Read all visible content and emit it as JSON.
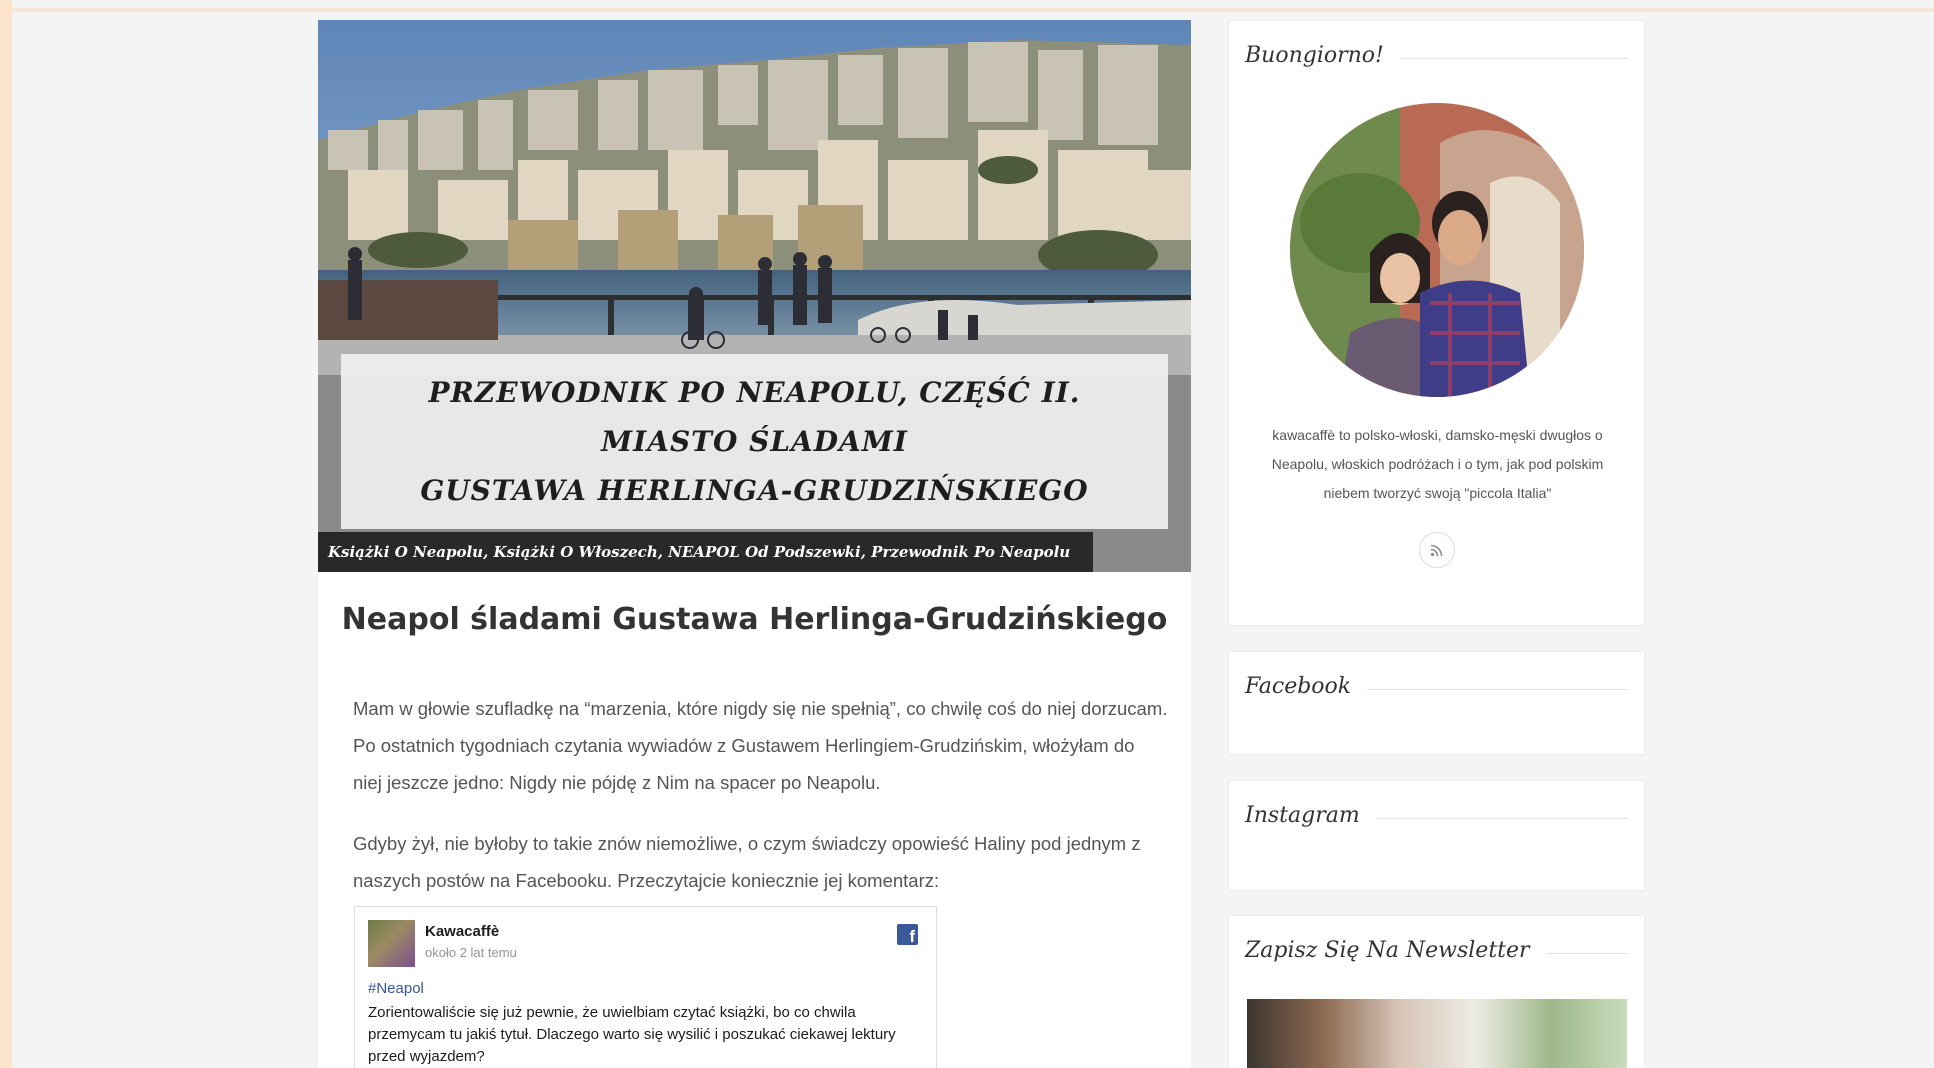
{
  "hero": {
    "caption_line1": "PRZEWODNIK PO NEAPOLU, CZĘŚĆ II.",
    "caption_line2": "MIASTO ŚLADAMI",
    "caption_line3": "GUSTAWA HERLINGA-GRUDZIŃSKIEGO",
    "categories": "Książki O Neapolu, Książki O Włoszech, NEAPOL Od Podszewki, Przewodnik Po Neapolu"
  },
  "post": {
    "title": "Neapol śladami Gustawa Herlinga-Grudzińskiego",
    "paragraph1": "Mam w głowie szufladkę na “marzenia, które nigdy się nie spełnią”, co chwilę coś do niej dorzucam. Po ostatnich tygodniach czytania wywiadów z Gustawem Herlingiem-Grudzińskim, włożyłam do niej jeszcze jedno: Nigdy nie pójdę z Nim na spacer po Neapolu.",
    "paragraph2": "Gdyby żył, nie byłoby to takie znów niemożliwe, o czym świadczy opowieść Haliny pod jednym z naszych postów na Facebooku. Przeczytajcie koniecznie jej komentarz:"
  },
  "fb_embed": {
    "page_name": "Kawacaffè",
    "time": "około 2 lat temu",
    "hashtag": "#Neapol",
    "text": "Zorientowaliście się już pewnie, że uwielbiam czytać książki, bo co chwila przemycam tu jakiś tytuł. Dlaczego warto się wysilić i poszukać ciekawej lektury przed wyjazdem?",
    "logo_glyph": "f"
  },
  "sidebar": {
    "welcome_title": "Buongiorno!",
    "about": "kawacaffè to polsko-włoski, damsko-męski dwugłos o Neapolu, włoskich podróżach i o tym, jak pod polskim niebem tworzyć swoją \"piccola Italia\"",
    "facebook_title": "Facebook",
    "instagram_title": "Instagram",
    "newsletter_title": "Zapisz Się Na Newsletter"
  },
  "colors": {
    "outer_frame": "#fde4cc",
    "page_bg": "#f4f4f4",
    "facebook_blue": "#3b5998",
    "link_blue": "#365899"
  },
  "icons": [
    "rss-icon",
    "facebook-icon"
  ]
}
